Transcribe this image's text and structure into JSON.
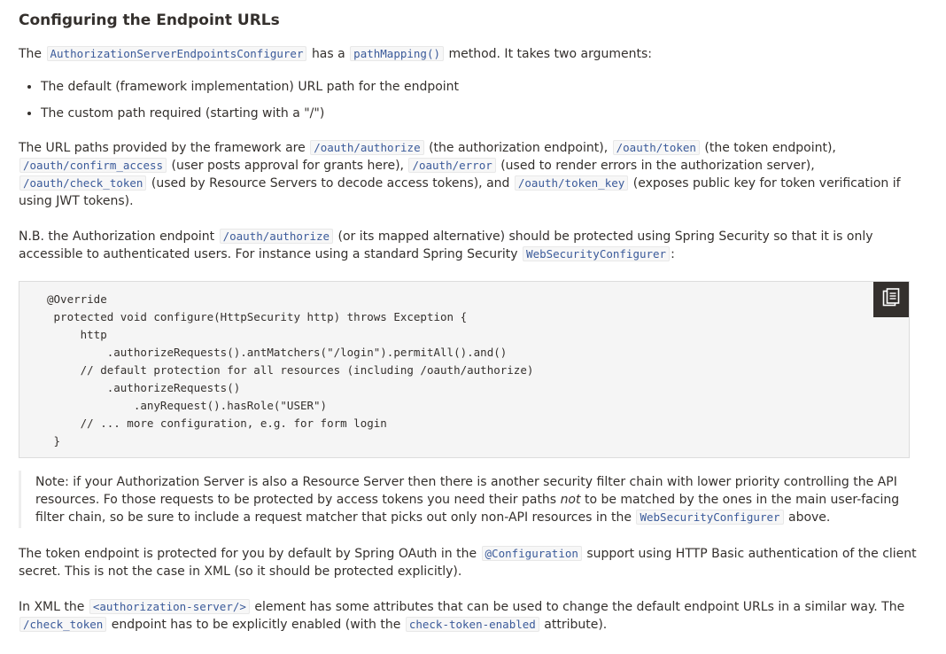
{
  "heading": "Configuring the Endpoint URLs",
  "p1": {
    "t1": "The",
    "c1": "AuthorizationServerEndpointsConfigurer",
    "t2": "has a",
    "c2": "pathMapping()",
    "t3": "method. It takes two arguments:"
  },
  "bullets": [
    "The default (framework implementation) URL path for the endpoint",
    "The custom path required (starting with a \"/\")"
  ],
  "p2": {
    "t1": "The URL paths provided by the framework are",
    "c1": "/oauth/authorize",
    "t2": "(the authorization endpoint),",
    "c2": "/oauth/token",
    "t3": "(the token endpoint),",
    "c3": "/oauth/confirm_access",
    "t4": "(user posts approval for grants here),",
    "c4": "/oauth/error",
    "t5": "(used to render errors in the authorization server),",
    "c5": "/oauth/check_token",
    "t6": "(used by Resource Servers to decode access tokens), and",
    "c6": "/oauth/token_key",
    "t7": "(exposes public key for token verification if using JWT tokens)."
  },
  "p3": {
    "t1": "N.B. the Authorization endpoint",
    "c1": "/oauth/authorize",
    "t2": "(or its mapped alternative) should be protected using Spring Security so that it is only accessible to authenticated users. For instance using a standard Spring Security",
    "c2": "WebSecurityConfigurer",
    "t3": ":"
  },
  "code_block": {
    "text": "@Override\n protected void configure(HttpSecurity http) throws Exception {\n     http\n         .authorizeRequests().antMatchers(\"/login\").permitAll().and()\n     // default protection for all resources (including /oauth/authorize)\n         .authorizeRequests()\n             .anyRequest().hasRole(\"USER\")\n     // ... more configuration, e.g. for form login\n }",
    "copy_icon": "clipboard-icon"
  },
  "note": {
    "t1": "Note: if your Authorization Server is also a Resource Server then there is another security filter chain with lower priority controlling the API resources. Fo those requests to be protected by access tokens you need their paths",
    "em": "not",
    "t2": "to be matched by the ones in the main user-facing filter chain, so be sure to include a request matcher that picks out only non-API resources in the",
    "c1": "WebSecurityConfigurer",
    "t3": "above."
  },
  "p4": {
    "t1": "The token endpoint is protected for you by default by Spring OAuth in the",
    "c1": "@Configuration",
    "t2": "support using HTTP Basic authentication of the client secret. This is not the case in XML (so it should be protected explicitly)."
  },
  "p5": {
    "t1": "In XML the",
    "c1": "<authorization-server/>",
    "t2": "element has some attributes that can be used to change the default endpoint URLs in a similar way. The",
    "c2": "/check_token",
    "t3": "endpoint has to be explicitly enabled (with the",
    "c3": "check-token-enabled",
    "t4": "attribute)."
  },
  "colors": {
    "text": "#34302d",
    "code_text": "#3a5a9a",
    "code_bg": "#f7f7f7",
    "copy_button_bg": "#34302d"
  }
}
